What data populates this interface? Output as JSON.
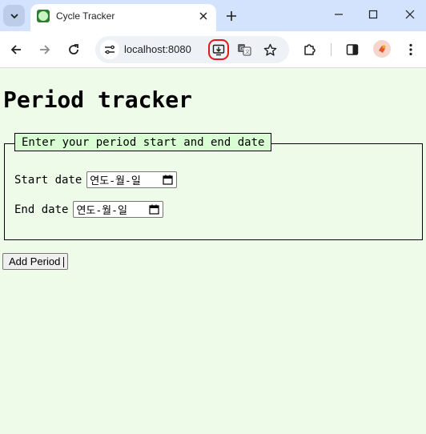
{
  "browser": {
    "tab_title": "Cycle Tracker",
    "url": "localhost:8080",
    "colors": {
      "tabbar": "#d3e3fd",
      "install_highlight": "#e01a1a"
    }
  },
  "page": {
    "heading": "Period tracker",
    "fieldset_legend": "Enter your period start and end date",
    "start_label": "Start date",
    "start_value": "연도-월-일",
    "end_label": "End date",
    "end_value": "연도-월-일",
    "add_button": "Add Period",
    "colors": {
      "background": "#eefbe9",
      "legend_bg": "#d9fed3"
    }
  }
}
